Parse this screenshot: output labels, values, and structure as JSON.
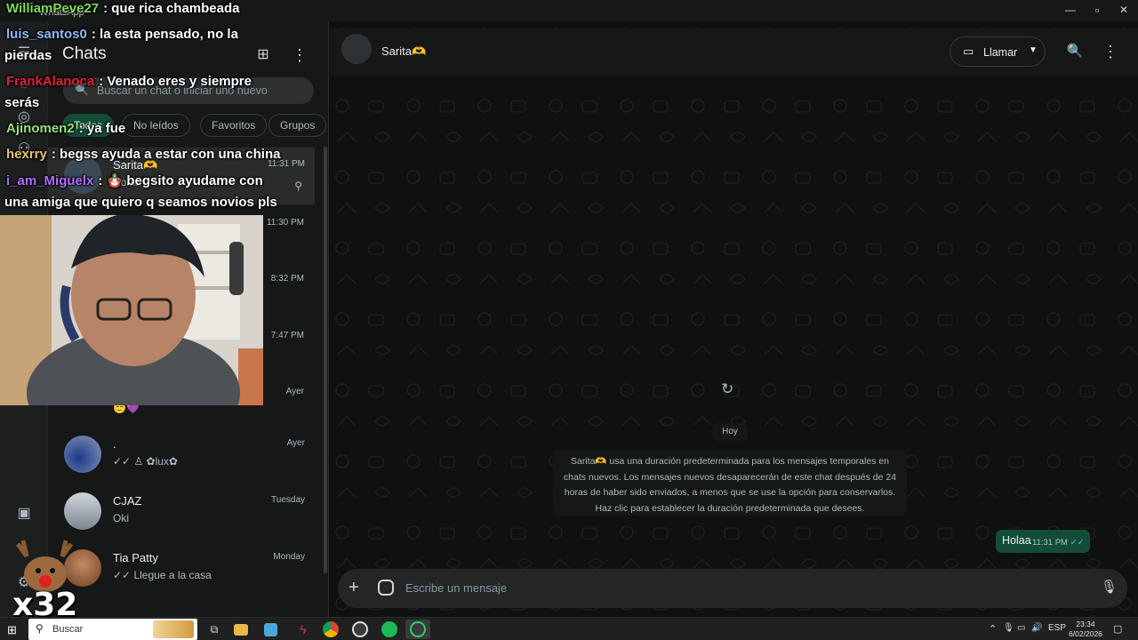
{
  "window": {
    "app_name": "WhatsApp",
    "minimize": "—",
    "maximize": "▫",
    "close": "✕"
  },
  "rail": {
    "icons": [
      "chats-icon",
      "status-icon",
      "channels-icon",
      "communities-icon",
      "media-icon",
      "settings-icon"
    ]
  },
  "sidebar": {
    "title": "Chats",
    "search_placeholder": "Buscar un chat o iniciar uno nuevo",
    "filters": [
      "Todos",
      "No leídos",
      "Favoritos",
      "Grupos"
    ],
    "chats": [
      {
        "name": "Sarita🫶",
        "preview": "Holaa",
        "time": "11:31 PM"
      },
      {
        "name": ".",
        "preview": "✓✓ ♙ ✿lux✿",
        "time": "Ayer"
      },
      {
        "name": "CJAZ",
        "preview": "Oki",
        "time": "Tuesday"
      },
      {
        "name": "Tia Patty",
        "preview": "✓✓ Llegue a la casa",
        "time": "Monday"
      }
    ],
    "partial_row_preview": "😇💜",
    "hidden_times": [
      "11:30 PM",
      "8:32 PM",
      "7:47 PM",
      "Ayer"
    ]
  },
  "conversation": {
    "contact_name": "Sarita🫶",
    "call_label": "Llamar",
    "day_label": "Hoy",
    "system_message": "Sarita🫶 usa una duración predeterminada para los mensajes temporales en chats nuevos. Los mensajes nuevos desaparecerán de este chat después de 24 horas de haber sido enviados, a menos que se use la opción para conservarlos. Haz clic para establecer la duración predeterminada que desees.",
    "messages": [
      {
        "text": "Holaa",
        "time": "11:31 PM",
        "ticks": "✓✓"
      }
    ],
    "composer_placeholder": "Escribe un mensaje"
  },
  "stream_chat": [
    {
      "user": "WilliamPeve27",
      "color": "#7ddc5a",
      "text": ": que rica chambeada"
    },
    {
      "user": "luis_santos0",
      "color": "#8fb8ff",
      "text": ": la esta pensado, no la"
    },
    {
      "user": "",
      "color": "#ffffff",
      "text": "pierdas"
    },
    {
      "user": "FrankAlanoca",
      "color": "#e0213a",
      "text": ": Venado eres y siempre"
    },
    {
      "user": "",
      "color": "#ffffff",
      "text": "serás"
    },
    {
      "user": "Ajinomen2",
      "color": "#9be07a",
      "text": ": ya fue"
    },
    {
      "user": "hexrry",
      "color": "#e6c46a",
      "text": ": begss ayuda a estar con una china"
    },
    {
      "user": "i_am_Miguelx",
      "color": "#b26bff",
      "text": ": 🪆 begsito ayudame con"
    },
    {
      "user": "",
      "color": "#ffffff",
      "text": "una amiga que quiero q seamos novios pls"
    }
  ],
  "overlay": {
    "multiplier": "x32"
  },
  "taskbar": {
    "search_label": "Buscar",
    "language": "ESP",
    "time": "23:34",
    "date": "6/02/2026",
    "apps": [
      "task-view-icon",
      "file-explorer-icon",
      "notepad-icon",
      "app-red-icon",
      "chrome-icon",
      "obs-icon",
      "spotify-icon",
      "whatsapp-icon"
    ]
  },
  "colors": {
    "accent": "#144d37",
    "whatsapp_green": "#25d366",
    "bg": "#161717"
  }
}
